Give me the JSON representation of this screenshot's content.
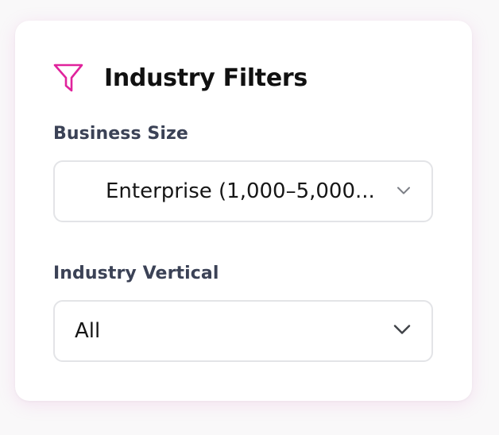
{
  "panel": {
    "title": "Industry Filters",
    "accent_color": "#e0239c",
    "icon": "filter-funnel-icon"
  },
  "business_size": {
    "label": "Business Size",
    "selected": "Enterprise (1,000–5,000...",
    "icon": "chevron-down-icon"
  },
  "industry_vertical": {
    "label": "Industry Vertical",
    "selected": "All",
    "icon": "chevron-down-icon"
  }
}
